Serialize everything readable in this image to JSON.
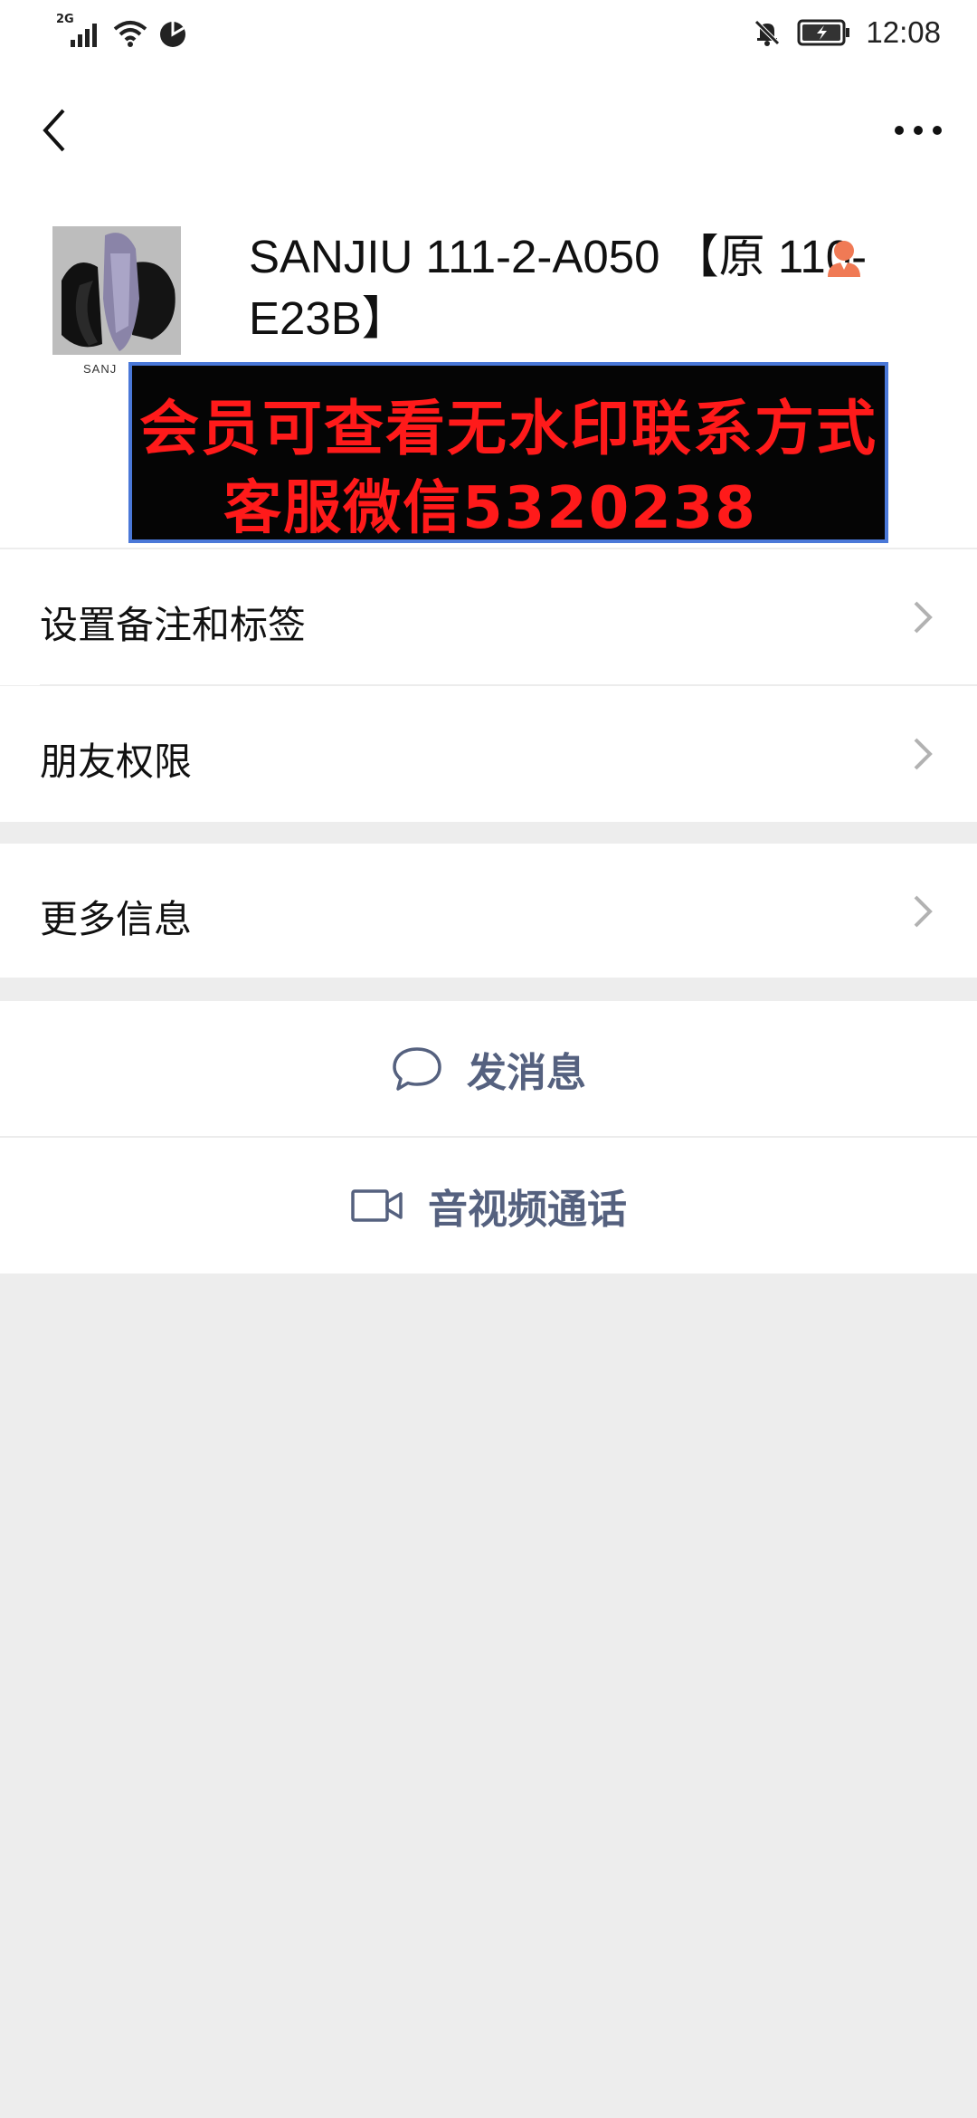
{
  "status_bar": {
    "network": "2G",
    "time": "12:08"
  },
  "profile": {
    "avatar_caption": "SANJ",
    "name": "SANJIU 111-2-A050 【原 110-E23B】"
  },
  "watermark": {
    "line1": "会员可查看无水印联系方式",
    "line2": "客服微信5320238"
  },
  "menu": {
    "remark": "设置备注和标签",
    "permissions": "朋友权限",
    "more_info": "更多信息"
  },
  "actions": {
    "message": "发消息",
    "call": "音视频通话"
  },
  "colors": {
    "action_text": "#55617f",
    "watermark_text": "#ff1a1a",
    "background": "#ededed"
  }
}
